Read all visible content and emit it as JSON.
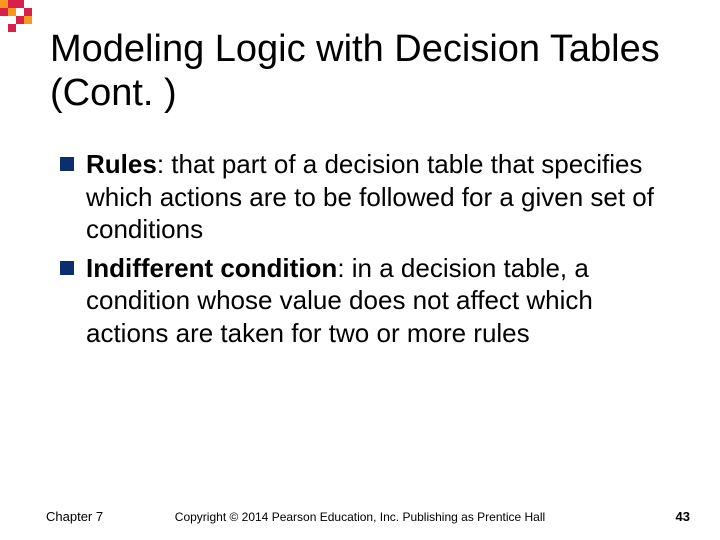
{
  "title": "Modeling Logic with Decision Tables (Cont. )",
  "bullets": [
    {
      "term": "Rules",
      "text": ": that part of a decision table that specifies which actions are to be followed for a given set of conditions"
    },
    {
      "term": "Indifferent condition",
      "text": ": in a decision table, a condition whose value does not affect which actions are taken for two or more rules"
    }
  ],
  "footer": {
    "chapter": "Chapter 7",
    "copyright": "Copyright © 2014 Pearson Education, Inc. Publishing as Prentice Hall",
    "page": "43"
  }
}
